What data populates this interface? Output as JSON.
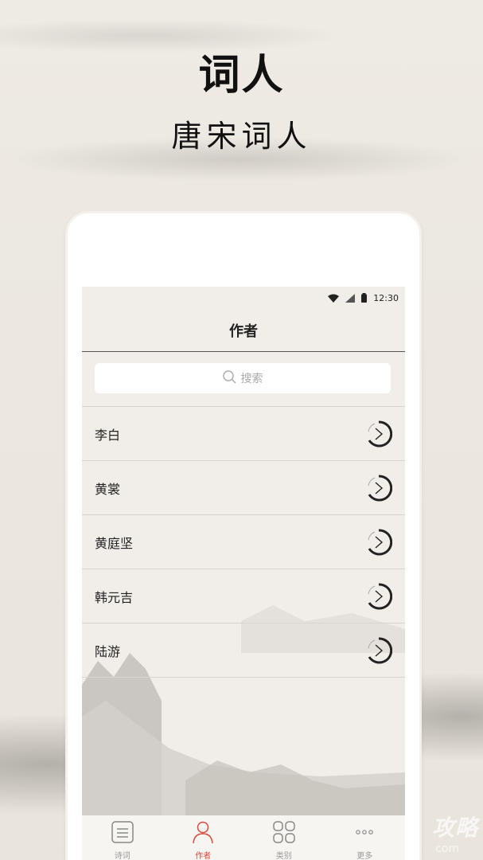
{
  "headline": "词人",
  "subline": "唐宋词人",
  "status_bar": {
    "time": "12:30"
  },
  "nav": {
    "title": "作者"
  },
  "search": {
    "placeholder": "搜索"
  },
  "authors": [
    {
      "name": "李白"
    },
    {
      "name": "黄裳"
    },
    {
      "name": "黄庭坚"
    },
    {
      "name": "韩元吉"
    },
    {
      "name": "陆游"
    }
  ],
  "tabs": [
    {
      "label": "诗词",
      "icon": "book-icon",
      "active": false
    },
    {
      "label": "作者",
      "icon": "person-icon",
      "active": true
    },
    {
      "label": "类别",
      "icon": "grid-icon",
      "active": false
    },
    {
      "label": "更多",
      "icon": "more-icon",
      "active": false
    }
  ],
  "watermark": {
    "text": "攻略",
    "sub": "com"
  },
  "colors": {
    "accent": "#d9493b",
    "background": "#ece7e0",
    "text": "#222222"
  }
}
